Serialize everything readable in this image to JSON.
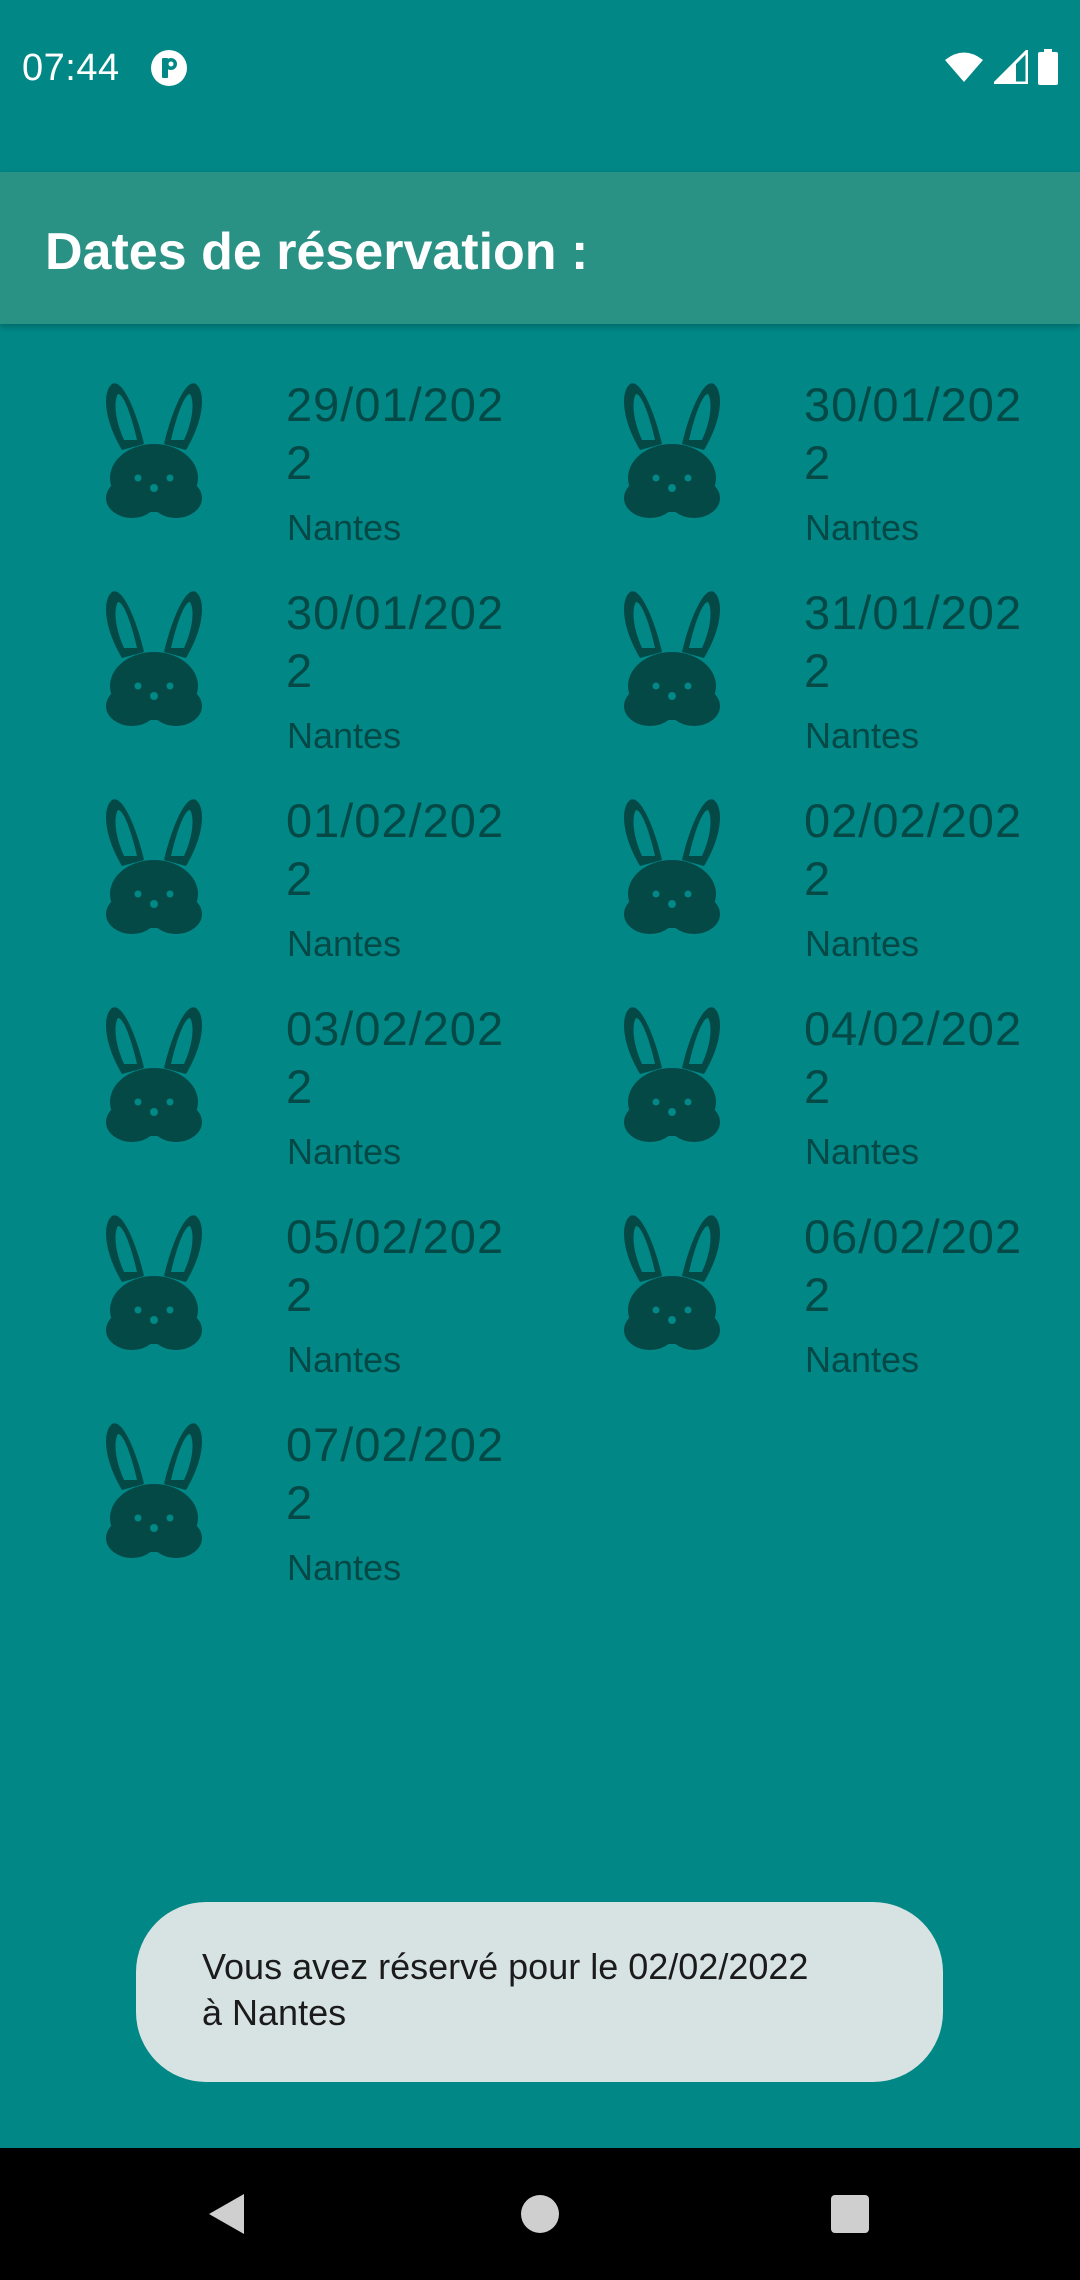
{
  "status_bar": {
    "time": "07:44",
    "app_icon": "pocket-circle-icon",
    "icons": [
      "wifi-icon",
      "cell-signal-icon",
      "battery-icon"
    ]
  },
  "app_bar": {
    "title": "Dates de réservation :"
  },
  "reservations": [
    {
      "date": "29/01/2022",
      "city": "Nantes",
      "icon": "rabbit-icon"
    },
    {
      "date": "30/01/2022",
      "city": "Nantes",
      "icon": "rabbit-icon"
    },
    {
      "date": "30/01/2022",
      "city": "Nantes",
      "icon": "rabbit-icon"
    },
    {
      "date": "31/01/2022",
      "city": "Nantes",
      "icon": "rabbit-icon"
    },
    {
      "date": "01/02/2022",
      "city": "Nantes",
      "icon": "rabbit-icon"
    },
    {
      "date": "02/02/2022",
      "city": "Nantes",
      "icon": "rabbit-icon"
    },
    {
      "date": "03/02/2022",
      "city": "Nantes",
      "icon": "rabbit-icon"
    },
    {
      "date": "04/02/2022",
      "city": "Nantes",
      "icon": "rabbit-icon"
    },
    {
      "date": "05/02/2022",
      "city": "Nantes",
      "icon": "rabbit-icon"
    },
    {
      "date": "06/02/2022",
      "city": "Nantes",
      "icon": "rabbit-icon"
    },
    {
      "date": "07/02/2022",
      "city": "Nantes",
      "icon": "rabbit-icon"
    }
  ],
  "toast": {
    "message": "Vous avez réservé pour le 02/02/2022\n à Nantes"
  },
  "nav_bar": {
    "icons": [
      "back-triangle-icon",
      "home-circle-icon",
      "recents-square-icon"
    ]
  },
  "colors": {
    "background": "#018786",
    "app_bar": "#2a9284",
    "text_dark": "#054947",
    "toast_bg": "#d7e3e2"
  }
}
